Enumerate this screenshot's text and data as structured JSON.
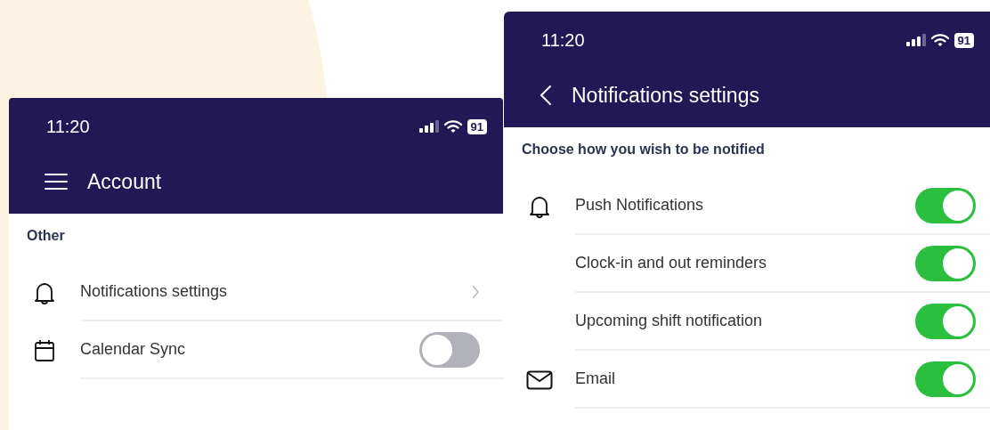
{
  "screens": [
    {
      "status_bar": {
        "time": "11:20",
        "battery": "91"
      },
      "header": {
        "title": "Account"
      },
      "section": "Other",
      "rows": [
        {
          "label": "Notifications settings",
          "kind": "link"
        },
        {
          "label": "Calendar Sync",
          "kind": "toggle",
          "on": false
        }
      ]
    },
    {
      "status_bar": {
        "time": "11:20",
        "battery": "91"
      },
      "header": {
        "title": "Notifications settings"
      },
      "section": "Choose how you wish to be notified",
      "rows": [
        {
          "label": "Push Notifications",
          "kind": "toggle",
          "on": true
        },
        {
          "label": "Clock-in and out reminders",
          "kind": "toggle",
          "on": true
        },
        {
          "label": "Upcoming shift notification",
          "kind": "toggle",
          "on": true
        },
        {
          "label": "Email",
          "kind": "toggle",
          "on": true
        }
      ]
    }
  ]
}
